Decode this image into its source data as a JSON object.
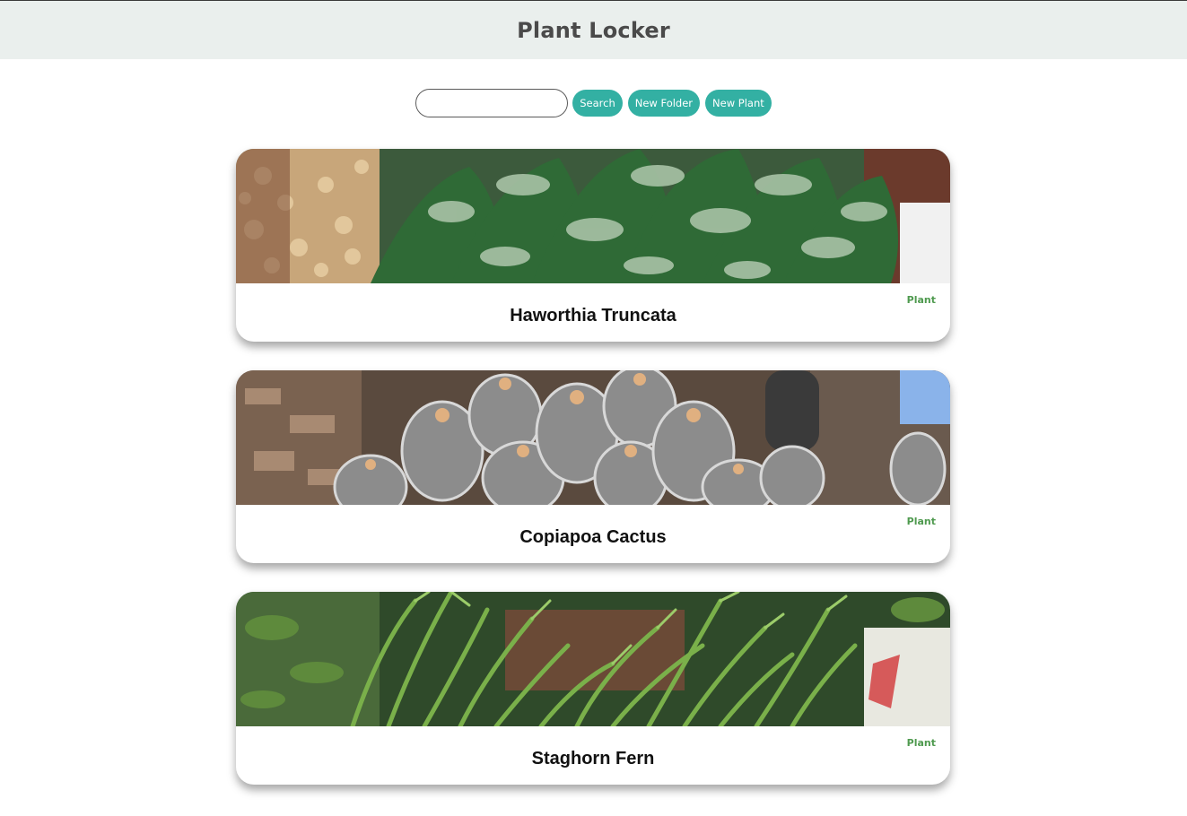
{
  "app": {
    "title": "Plant Locker"
  },
  "toolbar": {
    "search_value": "",
    "search_placeholder": "",
    "search_label": "Search",
    "new_folder_label": "New Folder",
    "new_plant_label": "New Plant",
    "accent_color": "#33b0a3"
  },
  "cards": [
    {
      "name": "Haworthia Truncata",
      "type": "Plant",
      "image": "haworthia-succulent-photo"
    },
    {
      "name": "Copiapoa Cactus",
      "type": "Plant",
      "image": "copiapoa-cactus-photo"
    },
    {
      "name": "Staghorn Fern",
      "type": "Plant",
      "image": "staghorn-fern-photo"
    }
  ],
  "colors": {
    "header_bg": "#eaefed",
    "type_label": "#4f9a4f"
  }
}
